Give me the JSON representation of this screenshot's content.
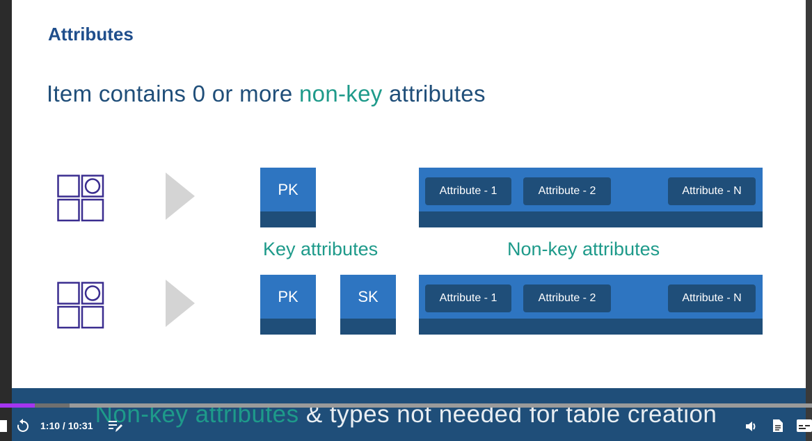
{
  "slide": {
    "title": "Attributes",
    "headline_parts": [
      "Item contains 0 or more ",
      "non-key",
      " attributes"
    ],
    "row1": {
      "keys": [
        "PK"
      ],
      "attributes": [
        "Attribute - 1",
        "Attribute - 2",
        "Attribute - N"
      ]
    },
    "row2": {
      "keys": [
        "PK",
        "SK"
      ],
      "attributes": [
        "Attribute - 1",
        "Attribute - 2",
        "Attribute - N"
      ]
    },
    "captions": {
      "key": "Key attributes",
      "nonkey": "Non-key attributes"
    }
  },
  "subtitle": {
    "highlight": "Non-key attributes",
    "rest": " & types not needed for table creation"
  },
  "player": {
    "time": "1:10 / 10:31",
    "progress_fraction": 0.111,
    "icons": [
      "rewind-icon",
      "notes-icon",
      "volume-icon",
      "transcript-icon",
      "captions-icon"
    ]
  },
  "colors": {
    "accent_blue": "#2e75c1",
    "dark_blue": "#1f4e79",
    "teal": "#1e9a8a",
    "title_blue": "#1f4e8c",
    "progress": "#a435f0"
  }
}
